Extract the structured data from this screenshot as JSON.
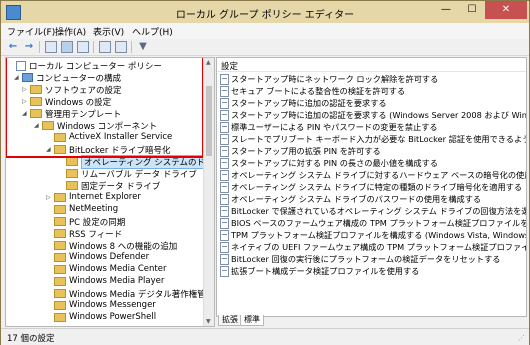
{
  "window": {
    "title": "ローカル グループ ポリシー エディター",
    "min_glyph": "—",
    "max_glyph": "☐",
    "close_glyph": "✕"
  },
  "menu": [
    {
      "label": "ファイル(F)"
    },
    {
      "label": "操作(A)"
    },
    {
      "label": "表示(V)"
    },
    {
      "label": "ヘルプ(H)"
    }
  ],
  "toolbar": {
    "back_icon": "←",
    "forward_icon": "→",
    "filter_icon": "▼"
  },
  "tree": [
    {
      "label": "ローカル コンピューター ポリシー",
      "icon": "pol",
      "exp": "",
      "indent": 0,
      "selected": false
    },
    {
      "label": "コンピューターの構成",
      "icon": "comp",
      "exp": "◢",
      "indent": 1,
      "selected": false
    },
    {
      "label": "ソフトウェアの設定",
      "icon": "folder",
      "exp": "▷",
      "indent": 2,
      "selected": false
    },
    {
      "label": "Windows の設定",
      "icon": "folder",
      "exp": "▷",
      "indent": 2,
      "selected": false
    },
    {
      "label": "管理用テンプレート",
      "icon": "folder",
      "exp": "◢",
      "indent": 2,
      "selected": false
    },
    {
      "label": "Windows コンポーネント",
      "icon": "folder",
      "exp": "◢",
      "indent": 3,
      "selected": false
    },
    {
      "label": "ActiveX Installer Service",
      "icon": "folder",
      "exp": "",
      "indent": 4,
      "selected": false
    },
    {
      "label": "BitLocker ドライブ暗号化",
      "icon": "folder",
      "exp": "◢",
      "indent": 4,
      "selected": false
    },
    {
      "label": "オペレーティング システムのドライブ",
      "icon": "folder",
      "exp": "",
      "indent": 5,
      "selected": true
    },
    {
      "label": "リムーバブル データ ドライブ",
      "icon": "folder",
      "exp": "",
      "indent": 5,
      "selected": false
    },
    {
      "label": "固定データ ドライブ",
      "icon": "folder",
      "exp": "",
      "indent": 5,
      "selected": false
    },
    {
      "label": "Internet Explorer",
      "icon": "folder",
      "exp": "▷",
      "indent": 4,
      "selected": false
    },
    {
      "label": "NetMeeting",
      "icon": "folder",
      "exp": "",
      "indent": 4,
      "selected": false
    },
    {
      "label": "PC 設定の同期",
      "icon": "folder",
      "exp": "",
      "indent": 4,
      "selected": false
    },
    {
      "label": "RSS フィード",
      "icon": "folder",
      "exp": "",
      "indent": 4,
      "selected": false
    },
    {
      "label": "Windows 8 への機能の追加",
      "icon": "folder",
      "exp": "",
      "indent": 4,
      "selected": false
    },
    {
      "label": "Windows Defender",
      "icon": "folder",
      "exp": "",
      "indent": 4,
      "selected": false
    },
    {
      "label": "Windows Media Center",
      "icon": "folder",
      "exp": "",
      "indent": 4,
      "selected": false
    },
    {
      "label": "Windows Media Player",
      "icon": "folder",
      "exp": "",
      "indent": 4,
      "selected": false
    },
    {
      "label": "Windows Media デジタル著作権管理",
      "icon": "folder",
      "exp": "",
      "indent": 4,
      "selected": false
    },
    {
      "label": "Windows Messenger",
      "icon": "folder",
      "exp": "",
      "indent": 4,
      "selected": false
    },
    {
      "label": "Windows PowerShell",
      "icon": "folder",
      "exp": "",
      "indent": 4,
      "selected": false
    }
  ],
  "list": {
    "header": "設定",
    "items": [
      "スタートアップ時にネットワーク ロック解除を許可する",
      "セキュア ブートによる整合性の検証を許可する",
      "スタートアップ時に追加の認証を要求する",
      "スタートアップ時に追加の認証を要求する (Windows Server 2008 および Windows Vista)",
      "標準ユーザーによる PIN やパスワードの変更を禁止する",
      "スレートでプリブート キーボード入力が必要な BitLocker 認証を使用できるようにする",
      "スタートアップ用の拡張 PIN を許可する",
      "スタートアップに対する PIN の長さの最小値を構成する",
      "オペレーティング システム ドライブに対するハードウェア ベースの暗号化の使用を構成する",
      "オペレーティング システム ドライブに特定の種類のドライブ暗号化を適用する",
      "オペレーティング システム ドライブのパスワードの使用を構成する",
      "BitLocker で保護されているオペレーティング システム ドライブの回復方法を選択する",
      "BIOS ベースのファームウェア構成の TPM プラットフォーム検証プロファイルを構成する",
      "TPM プラットフォーム検証プロファイルを構成する (Windows Vista, Windows Server 20...",
      "ネイティブの UEFI ファームウェア構成の TPM プラットフォーム検証プロファイルを構成する",
      "BitLocker 回復の実行後にプラットフォームの検証データをリセットする",
      "拡張ブート構成データ検証プロファイルを使用する"
    ]
  },
  "tabs": [
    {
      "label": "拡張",
      "active": false
    },
    {
      "label": "標準",
      "active": true
    }
  ],
  "status": {
    "text": "17 個の設定"
  }
}
